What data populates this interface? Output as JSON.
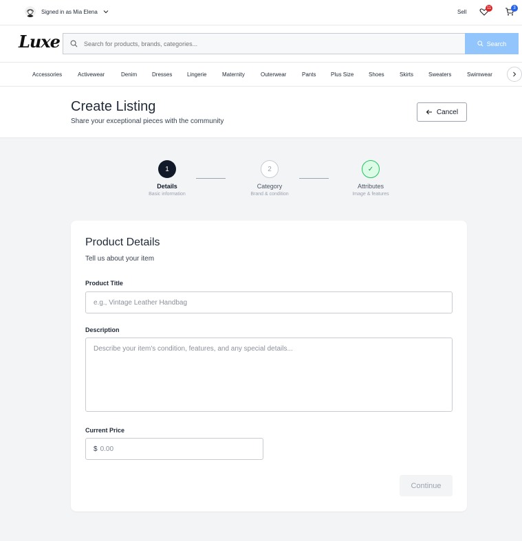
{
  "topbar": {
    "user_label": "Signed in as Mia Elena",
    "sell_label": "Sell",
    "favorites_count": "11",
    "cart_count": "3"
  },
  "header": {
    "logo_text": "Luxe",
    "search_placeholder": "Search for products, brands, categories...",
    "search_button": "Search"
  },
  "categories": [
    "Accessories",
    "Activewear",
    "Denim",
    "Dresses",
    "Lingerie",
    "Maternity",
    "Outerwear",
    "Pants",
    "Plus Size",
    "Shoes",
    "Skirts",
    "Sweaters",
    "Swimwear"
  ],
  "page": {
    "title": "Create Listing",
    "subtitle": "Share your exceptional pieces with the community",
    "cancel_label": "Cancel"
  },
  "steps": [
    {
      "number": "1",
      "title": "Details",
      "desc": "Basic information",
      "state": "active"
    },
    {
      "number": "2",
      "title": "Category",
      "desc": "Brand & condition",
      "state": "pending"
    },
    {
      "number": "✓",
      "title": "Attributes",
      "desc": "Image & features",
      "state": "complete"
    }
  ],
  "form": {
    "title": "Product Details",
    "subtitle": "Tell us about your item",
    "product_title_label": "Product Title",
    "product_title_placeholder": "e.g., Vintage Leather Handbag",
    "product_title_value": "",
    "description_label": "Description",
    "description_placeholder": "Describe your item's condition, features, and any special details...",
    "description_value": "",
    "price_label": "Current Price",
    "price_currency": "$",
    "price_placeholder": "0.00",
    "price_value": "",
    "continue_label": "Continue"
  },
  "colors": {
    "badge_red": "#dc2626",
    "badge_blue": "#2563eb",
    "search_button": "#93c5fd",
    "step_active": "#111827",
    "step_complete": "#22c55e"
  },
  "icons": {
    "avatar": "user-avatar-icon",
    "user_menu": "chevron-down-icon",
    "favorites": "heart-icon",
    "cart": "cart-icon",
    "search": "search-icon",
    "nav_more": "chevron-right-icon",
    "cancel": "arrow-left-icon"
  }
}
